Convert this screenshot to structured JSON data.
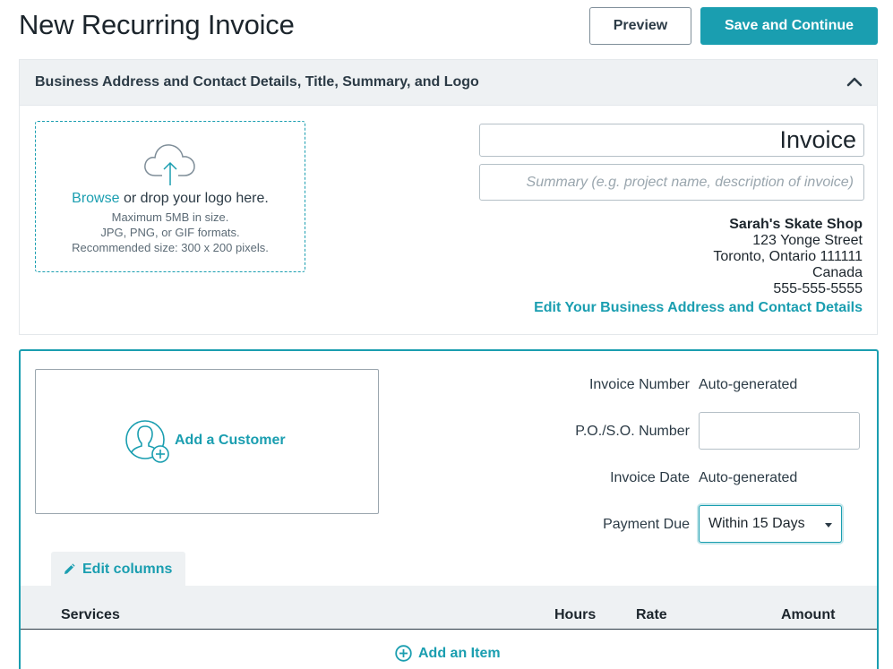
{
  "page": {
    "title": "New Recurring Invoice",
    "preview_label": "Preview",
    "save_label": "Save and Continue"
  },
  "colors": {
    "accent": "#1a9eb0",
    "panel_bg": "#eef1f3",
    "text": "#1c252c"
  },
  "header_section": {
    "title": "Business Address and Contact Details, Title, Summary, and Logo",
    "collapse_icon": "chevron-up-icon",
    "logo": {
      "icon": "cloud-upload-icon",
      "browse_label": "Browse",
      "drop_text": " or drop your logo here.",
      "hint_size": "Maximum 5MB in size.",
      "hint_formats": "JPG, PNG, or GIF formats.",
      "hint_recommended": "Recommended size: 300 x 200 pixels."
    },
    "invoice_title_value": "Invoice",
    "summary_placeholder": "Summary (e.g. project name, description of invoice)",
    "business": {
      "name": "Sarah's Skate Shop",
      "street": "123 Yonge Street",
      "city": "Toronto, Ontario 111111",
      "country": "Canada",
      "phone": "555-555-5555"
    },
    "edit_business_label": "Edit Your Business Address and Contact Details"
  },
  "invoice_section": {
    "add_customer_label": "Add a Customer",
    "customer_icon": "add-user-icon",
    "invoice_number_label": "Invoice Number",
    "invoice_number_value": "Auto-generated",
    "po_label": "P.O./S.O. Number",
    "po_value": "",
    "invoice_date_label": "Invoice Date",
    "invoice_date_value": "Auto-generated",
    "payment_due_label": "Payment Due",
    "payment_due_value": "Within 15 Days",
    "edit_columns_label": "Edit columns",
    "table_headers": {
      "services": "Services",
      "hours": "Hours",
      "rate": "Rate",
      "amount": "Amount"
    },
    "add_item_label": "Add an Item"
  }
}
